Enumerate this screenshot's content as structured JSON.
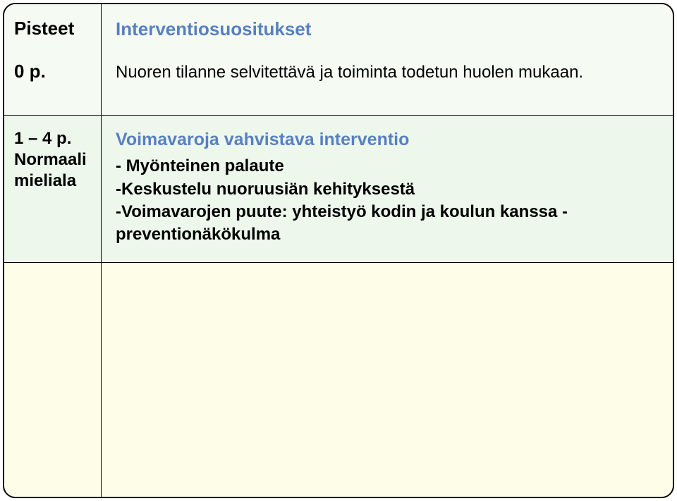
{
  "header": {
    "left": {
      "title": "Pisteet",
      "score": "0 p."
    },
    "right": {
      "title": "Interventiosuositukset",
      "subtitle": "Nuoren tilanne selvitettävä ja toiminta todetun huolen mukaan."
    }
  },
  "section1": {
    "left": {
      "range": "1 – 4 p.",
      "label1": "Normaali",
      "label2": "mieliala"
    },
    "right": {
      "title": "Voimavaroja vahvistava interventio",
      "items": [
        "- Myönteinen palaute",
        "-Keskustelu nuoruusiän kehityksestä",
        "-Voimavarojen puute: yhteistyö kodin ja koulun kanssa -preventionäkökulma"
      ]
    }
  }
}
